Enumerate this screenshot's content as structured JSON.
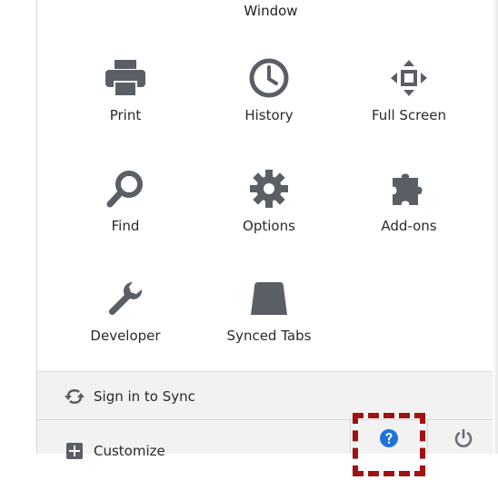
{
  "menu": {
    "partial_top_label": "Window",
    "tiles": [
      {
        "label": "Print",
        "icon": "printer-icon"
      },
      {
        "label": "History",
        "icon": "clock-icon"
      },
      {
        "label": "Full Screen",
        "icon": "fullscreen-arrows-icon"
      },
      {
        "label": "Find",
        "icon": "magnifier-icon"
      },
      {
        "label": "Options",
        "icon": "gear-icon"
      },
      {
        "label": "Add-ons",
        "icon": "puzzle-piece-icon"
      },
      {
        "label": "Developer",
        "icon": "wrench-icon"
      },
      {
        "label": "Synced Tabs",
        "icon": "synced-tabs-icon"
      }
    ]
  },
  "footer": {
    "sync_label": "Sign in to Sync",
    "customize_label": "Customize",
    "help_icon": "help-question-icon",
    "quit_icon": "power-icon"
  },
  "colors": {
    "icon_gray": "#5a5f66",
    "help_blue": "#1e73d8",
    "highlight_red": "#a01212",
    "footer_bg": "#f2f2f2"
  }
}
